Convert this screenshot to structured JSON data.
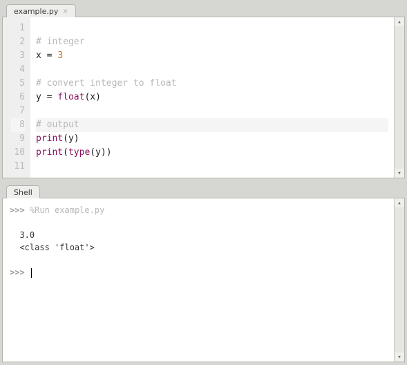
{
  "editor": {
    "tab_label": "example.py",
    "lines": [
      {
        "num": "1",
        "segments": []
      },
      {
        "num": "2",
        "segments": [
          {
            "t": "# integer",
            "c": "comment"
          }
        ]
      },
      {
        "num": "3",
        "segments": [
          {
            "t": "x = ",
            "c": ""
          },
          {
            "t": "3",
            "c": "num"
          }
        ]
      },
      {
        "num": "4",
        "segments": []
      },
      {
        "num": "5",
        "segments": [
          {
            "t": "# convert integer to float",
            "c": "comment"
          }
        ]
      },
      {
        "num": "6",
        "segments": [
          {
            "t": "y = ",
            "c": ""
          },
          {
            "t": "float",
            "c": "builtin"
          },
          {
            "t": "(x)",
            "c": ""
          }
        ]
      },
      {
        "num": "7",
        "segments": []
      },
      {
        "num": "8",
        "segments": [
          {
            "t": "# output",
            "c": "comment"
          }
        ],
        "hl": true
      },
      {
        "num": "9",
        "segments": [
          {
            "t": "print",
            "c": "builtin"
          },
          {
            "t": "(y)",
            "c": ""
          }
        ]
      },
      {
        "num": "10",
        "segments": [
          {
            "t": "print",
            "c": "builtin"
          },
          {
            "t": "(",
            "c": ""
          },
          {
            "t": "type",
            "c": "builtin"
          },
          {
            "t": "(y))",
            "c": ""
          }
        ]
      },
      {
        "num": "11",
        "segments": []
      }
    ]
  },
  "shell": {
    "tab_label": "Shell",
    "prompt": ">>>",
    "run_line": "%Run example.py",
    "output": [
      "  3.0",
      "  <class 'float'>"
    ]
  },
  "scroll": {
    "up": "▴",
    "down": "▾"
  }
}
